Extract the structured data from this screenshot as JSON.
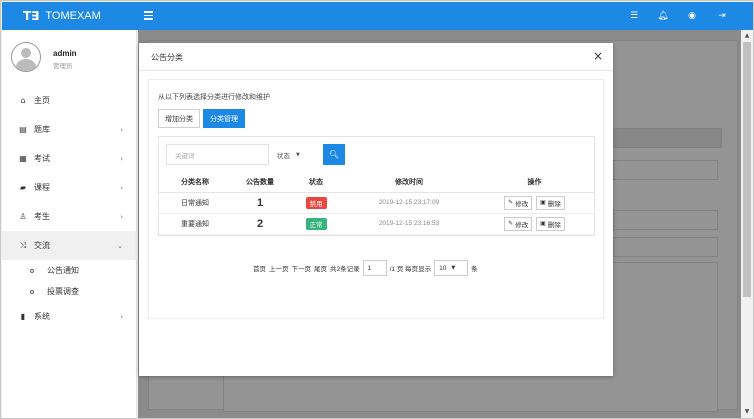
{
  "app": {
    "logo": "T∃",
    "title": "TOMEXAM"
  },
  "topbar_icons": [
    "list-icon",
    "bell-icon",
    "user-icon",
    "logout-icon"
  ],
  "user": {
    "name": "admin",
    "role": "管理员"
  },
  "sidebar": {
    "items": [
      {
        "label": "主页",
        "icon": "home-icon"
      },
      {
        "label": "题库",
        "icon": "database-icon",
        "arrow": "›"
      },
      {
        "label": "考试",
        "icon": "calendar-icon",
        "arrow": "›"
      },
      {
        "label": "课程",
        "icon": "book-icon",
        "arrow": "›"
      },
      {
        "label": "考生",
        "icon": "person-icon",
        "arrow": "›"
      },
      {
        "label": "交流",
        "icon": "shuffle-icon",
        "arrow": "⌄"
      },
      {
        "label": "系统",
        "icon": "system-icon",
        "arrow": "›"
      }
    ],
    "sub_items": [
      {
        "label": "公告通知"
      },
      {
        "label": "投票调查"
      }
    ]
  },
  "modal": {
    "title": "公告分类",
    "close": "×",
    "hint": "从以下列表选择分类进行修改和维护",
    "tabs": [
      {
        "label": "增加分类",
        "active": false
      },
      {
        "label": "分类管理",
        "active": true
      }
    ],
    "search": {
      "placeholder": "关键词",
      "status_label": "状态",
      "caret": "▼",
      "button_icon": "🔍︎"
    },
    "table": {
      "headers": [
        "分类名称",
        "公告数量",
        "状态",
        "修改时间",
        "操作"
      ],
      "rows": [
        {
          "name": "日常通知",
          "count": "1",
          "status": "禁用",
          "status_color": "#e8483f",
          "time": "2019-12-15 23:17:09",
          "edit": "修改",
          "delete": "删除"
        },
        {
          "name": "重要通知",
          "count": "2",
          "status": "正常",
          "status_color": "#36b37e",
          "time": "2019-12-15 23:16:53",
          "edit": "修改",
          "delete": "删除"
        }
      ]
    },
    "pager": {
      "first": "首页",
      "prev": "上一页",
      "next": "下一页",
      "last": "尾页",
      "total": "共2条记录",
      "page": "1",
      "pages": "/1 页 每页显示",
      "size": "10",
      "unit": "条"
    }
  }
}
